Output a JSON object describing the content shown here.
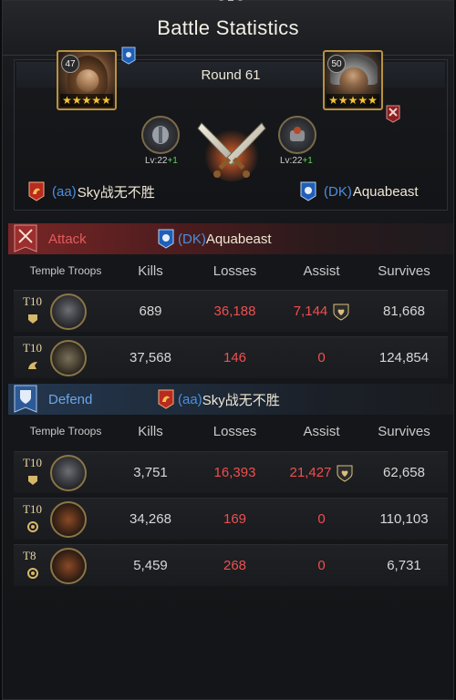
{
  "header": {
    "title": "Battle Statistics"
  },
  "round": {
    "label": "Round 61"
  },
  "attacker": {
    "level": "47",
    "stars": "★★★★★",
    "gear_level": "Lv:22",
    "gear_plus": "+1",
    "tag": "(aa)",
    "name": "Sky战无不胜"
  },
  "defender": {
    "level": "50",
    "stars": "★★★★★",
    "gear_level": "Lv:22",
    "gear_plus": "+1",
    "tag": "(DK)",
    "name": "Aquabeast"
  },
  "columns": {
    "troops": "Temple Troops",
    "kills": "Kills",
    "losses": "Losses",
    "assist": "Assist",
    "survives": "Survives"
  },
  "attack": {
    "label": "Attack",
    "opponent_tag": "(DK)",
    "opponent_name": "Aquabeast",
    "rows": [
      {
        "tier": "T10",
        "kills": "689",
        "losses": "36,188",
        "assist": "7,144",
        "survives": "81,668",
        "icon": "infantry-icon"
      },
      {
        "tier": "T10",
        "kills": "37,568",
        "losses": "146",
        "assist": "0",
        "survives": "124,854",
        "icon": "cavalry-icon"
      }
    ]
  },
  "defend": {
    "label": "Defend",
    "opponent_tag": "(aa)",
    "opponent_name": "Sky战无不胜",
    "rows": [
      {
        "tier": "T10",
        "kills": "3,751",
        "losses": "16,393",
        "assist": "21,427",
        "survives": "62,658",
        "icon": "infantry-icon"
      },
      {
        "tier": "T10",
        "kills": "34,268",
        "losses": "169",
        "assist": "0",
        "survives": "110,103",
        "icon": "siege-icon"
      },
      {
        "tier": "T8",
        "kills": "5,459",
        "losses": "268",
        "assist": "0",
        "survives": "6,731",
        "icon": "siege-icon"
      }
    ]
  },
  "colors": {
    "loss_red": "#ef4f4f",
    "tag_blue": "#4a8fe0",
    "attack_red": "#e25b5b",
    "defend_blue": "#6aa6e8"
  }
}
